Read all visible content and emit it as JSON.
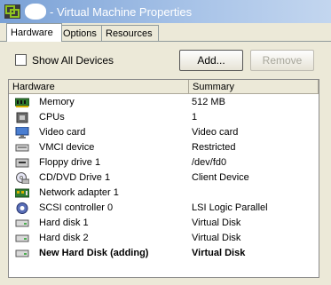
{
  "window": {
    "title": "- Virtual Machine Properties"
  },
  "tabs": [
    {
      "label": "Hardware"
    },
    {
      "label": "Options"
    },
    {
      "label": "Resources"
    }
  ],
  "toolbar": {
    "show_all_devices_label": "Show All Devices",
    "show_all_devices_checked": false,
    "add_label": "Add...",
    "remove_label": "Remove"
  },
  "columns": {
    "hardware": "Hardware",
    "summary": "Summary"
  },
  "devices": [
    {
      "name": "Memory",
      "summary": "512 MB",
      "icon": "memory-icon"
    },
    {
      "name": "CPUs",
      "summary": "1",
      "icon": "cpu-icon"
    },
    {
      "name": "Video card",
      "summary": "Video card",
      "icon": "monitor-icon"
    },
    {
      "name": "VMCI device",
      "summary": "Restricted",
      "icon": "vmci-device-icon"
    },
    {
      "name": "Floppy drive 1",
      "summary": "/dev/fd0",
      "icon": "floppy-drive-icon"
    },
    {
      "name": "CD/DVD Drive 1",
      "summary": "Client Device",
      "icon": "cd-dvd-icon"
    },
    {
      "name": "Network adapter 1",
      "summary": "",
      "icon": "network-adapter-icon"
    },
    {
      "name": "SCSI controller 0",
      "summary": "LSI Logic Parallel",
      "icon": "scsi-controller-icon"
    },
    {
      "name": "Hard disk 1",
      "summary": "Virtual Disk",
      "icon": "hard-disk-icon"
    },
    {
      "name": "Hard disk 2",
      "summary": "Virtual Disk",
      "icon": "hard-disk-icon"
    },
    {
      "name": "New Hard Disk (adding)",
      "summary": "Virtual Disk",
      "icon": "hard-disk-icon"
    }
  ]
}
